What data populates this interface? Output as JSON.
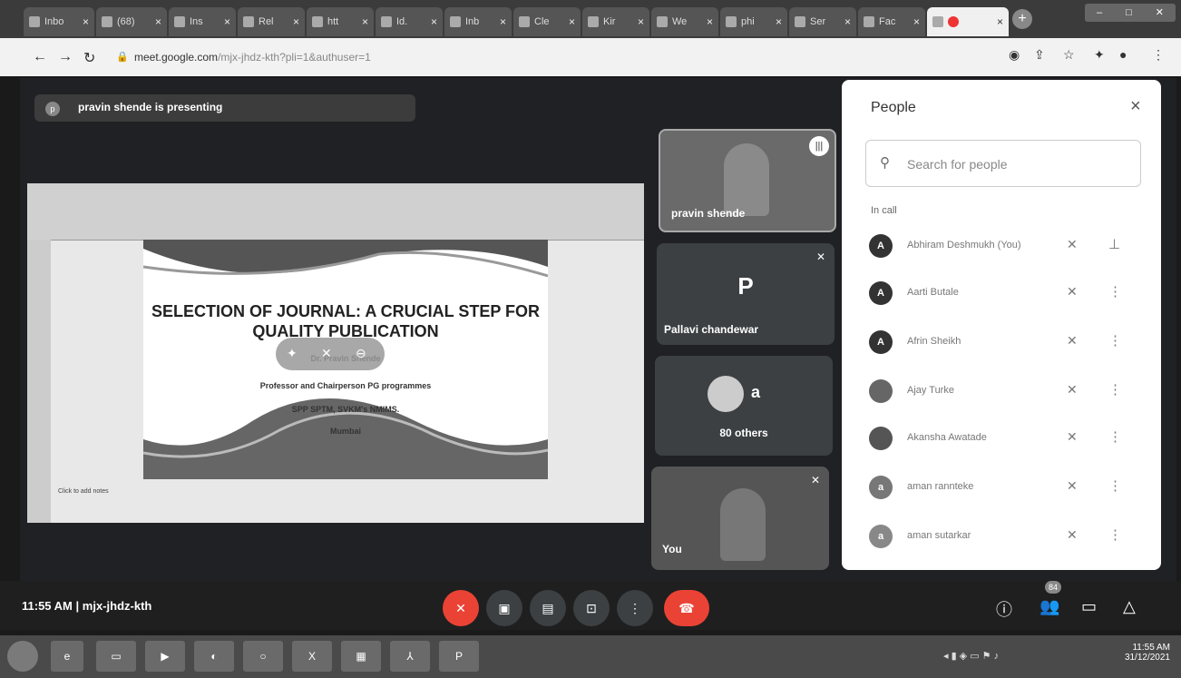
{
  "browser": {
    "tabs": [
      {
        "label": "Inbo"
      },
      {
        "label": "(68)"
      },
      {
        "label": "Ins"
      },
      {
        "label": "Rel"
      },
      {
        "label": "htt"
      },
      {
        "label": "Id."
      },
      {
        "label": "Inb"
      },
      {
        "label": "Cle"
      },
      {
        "label": "Kir"
      },
      {
        "label": "We"
      },
      {
        "label": "phi"
      },
      {
        "label": "Ser"
      },
      {
        "label": "Fac"
      },
      {
        "label": ""
      }
    ],
    "new_tab_symbol": "+",
    "url_main": "meet.google.com",
    "url_path": "/mjx-jhdz-kth?pli=1&authuser=1"
  },
  "meet": {
    "presenting_initial": "p",
    "presenting_text": "pravin shende is presenting",
    "slide": {
      "title_line1": "SELECTION OF JOURNAL: A CRUCIAL STEP FOR",
      "title_line2": "QUALITY PUBLICATION",
      "author": "Dr. Pravin Shende",
      "role": "Professor and Chairperson PG programmes",
      "institute": "SPP SPTM, SVKM's NMIMS.",
      "city": "Mumbai",
      "footer": "Click to add notes"
    },
    "tiles": {
      "presenter_name": "pravin shende",
      "tile2_initial": "P",
      "tile2_name": "Pallavi chandewar",
      "tile3_initial": "a",
      "tile3_others": "80 others",
      "tile4_name": "You"
    },
    "meeting_time": "11:55 AM",
    "meeting_separator": "|",
    "meeting_code": "mjx-jhdz-kth",
    "participant_badge": "84"
  },
  "people_panel": {
    "title": "People",
    "close_symbol": "×",
    "search_placeholder": "Search for people",
    "section_label": "In call",
    "participants": [
      {
        "initial": "A",
        "name": "Abhiram Deshmukh (You)"
      },
      {
        "initial": "A",
        "name": "Aarti Butale"
      },
      {
        "initial": "A",
        "name": "Afrin Sheikh"
      },
      {
        "initial": "",
        "name": "Ajay Turke"
      },
      {
        "initial": "",
        "name": "Akansha Awatade"
      },
      {
        "initial": "a",
        "name": "aman rannteke"
      },
      {
        "initial": "a",
        "name": "aman sutarkar"
      }
    ]
  },
  "taskbar": {
    "time": "11:55 AM",
    "date": "31/12/2021"
  }
}
